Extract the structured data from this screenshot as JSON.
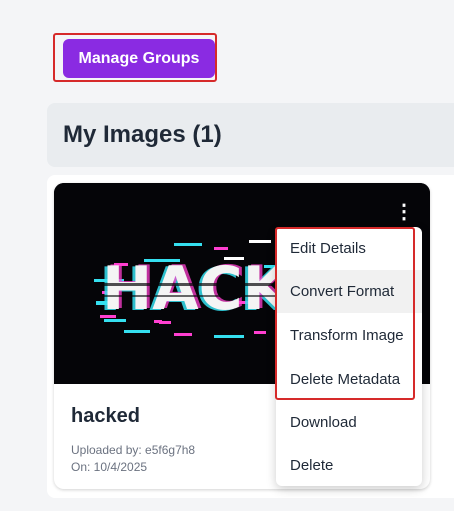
{
  "toolbar": {
    "manage_groups_label": "Manage Groups"
  },
  "section": {
    "title": "My Images (1)"
  },
  "card": {
    "title": "hacked",
    "image_text": "HACK",
    "uploaded_by": "Uploaded by: e5f6g7h8",
    "date": "On: 10/4/2025"
  },
  "menu": {
    "items": [
      {
        "label": "Edit Details"
      },
      {
        "label": "Convert Format"
      },
      {
        "label": "Transform Image"
      },
      {
        "label": "Delete Metadata"
      },
      {
        "label": "Download"
      },
      {
        "label": "Delete"
      }
    ]
  },
  "colors": {
    "accent": "#8a2be2",
    "highlight_outline": "#d62a2a",
    "glitch_cyan": "#35e0f0",
    "glitch_magenta": "#ff3fd0"
  }
}
